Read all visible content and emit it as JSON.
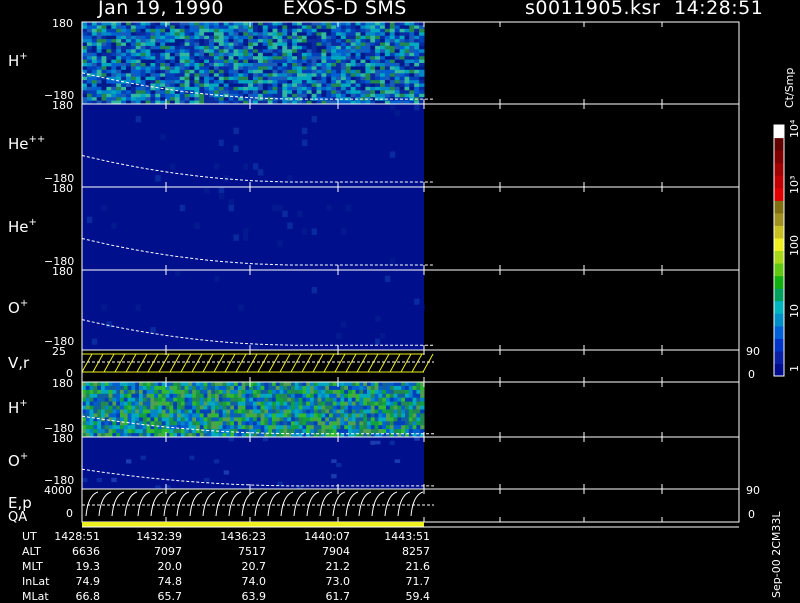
{
  "header": {
    "date": "Jan 19, 1990",
    "instrument": "EXOS-D SMS",
    "file": "s0011905.ksr",
    "time": "14:28:51"
  },
  "colorbar": {
    "unit": "Ct/Smp",
    "ticks": [
      "1",
      "10",
      "100",
      "10³",
      "10⁴"
    ],
    "colors": [
      "#000c8c",
      "#0a1fa6",
      "#0035c8",
      "#0060d8",
      "#008fc8",
      "#00b4c0",
      "#00a060",
      "#10b010",
      "#60c810",
      "#a8d818",
      "#f0f020",
      "#c8c020",
      "#a09020",
      "#807010",
      "#e00000",
      "#c00000",
      "#a00000",
      "#800000",
      "#600000",
      "#ffffff"
    ]
  },
  "panels": [
    {
      "id": "h-plus",
      "species": "H",
      "charge": "+",
      "ytop": "180",
      "ybot": "−180",
      "top": 22,
      "bottom": 104,
      "kind": "spectro",
      "intensity": "high"
    },
    {
      "id": "he-plusplus",
      "species": "He",
      "charge": "++",
      "ytop": "180",
      "ybot": "−180",
      "top": 104,
      "bottom": 187,
      "kind": "spectro",
      "intensity": "low"
    },
    {
      "id": "he-plus",
      "species": "He",
      "charge": "+",
      "ytop": "180",
      "ybot": "−180",
      "top": 187,
      "bottom": 270,
      "kind": "spectro",
      "intensity": "low"
    },
    {
      "id": "o-plus",
      "species": "O",
      "charge": "+",
      "ytop": "180",
      "ybot": "−180",
      "top": 270,
      "bottom": 350,
      "kind": "spectro",
      "intensity": "low"
    },
    {
      "id": "v-r",
      "species": "V,r",
      "charge": "",
      "ytop": "25",
      "ybot": "0",
      "rtop": "90",
      "rbot": "0",
      "top": 350,
      "bottom": 382,
      "kind": "line"
    },
    {
      "id": "h-plus-2",
      "species": "H",
      "charge": "+",
      "ytop": "180",
      "ybot": "−180",
      "top": 382,
      "bottom": 437,
      "kind": "spectro",
      "intensity": "mid"
    },
    {
      "id": "o-plus-2",
      "species": "O",
      "charge": "+",
      "ytop": "180",
      "ybot": "−180",
      "top": 437,
      "bottom": 489,
      "kind": "spectro",
      "intensity": "low2"
    },
    {
      "id": "e-p",
      "species": "E,p",
      "charge": "",
      "ytop": "4000",
      "ybot": "0",
      "rtop": "90",
      "rbot": "0",
      "top": 489,
      "bottom": 522,
      "kind": "line2"
    }
  ],
  "qa_label": "QA",
  "footer": {
    "rows": [
      {
        "label": "UT",
        "values": [
          "1428:51",
          "1432:39",
          "1436:23",
          "1440:07",
          "1443:51"
        ]
      },
      {
        "label": "ALT",
        "values": [
          "6636",
          "7097",
          "7517",
          "7904",
          "8257"
        ]
      },
      {
        "label": "MLT",
        "values": [
          "19.3",
          "20.0",
          "20.7",
          "21.2",
          "21.6"
        ]
      },
      {
        "label": "InLat",
        "values": [
          "74.9",
          "74.8",
          "74.0",
          "73.0",
          "71.7"
        ]
      },
      {
        "label": "MLat",
        "values": [
          "66.8",
          "65.7",
          "63.9",
          "61.7",
          "59.4"
        ]
      }
    ]
  },
  "side_code": "Sep-00 2CM33L",
  "chart_data": {
    "type": "heatmap",
    "title": "Jan 19, 1990   EXOS-D SMS",
    "x": [
      "1428:51",
      "1432:39",
      "1436:23",
      "1440:07",
      "1443:51"
    ],
    "series": [
      {
        "name": "H+"
      },
      {
        "name": "He++"
      },
      {
        "name": "He+"
      },
      {
        "name": "O+"
      },
      {
        "name": "V,r"
      },
      {
        "name": "H+"
      },
      {
        "name": "O+"
      },
      {
        "name": "E,p"
      }
    ],
    "legend": "right",
    "grid": true
  }
}
